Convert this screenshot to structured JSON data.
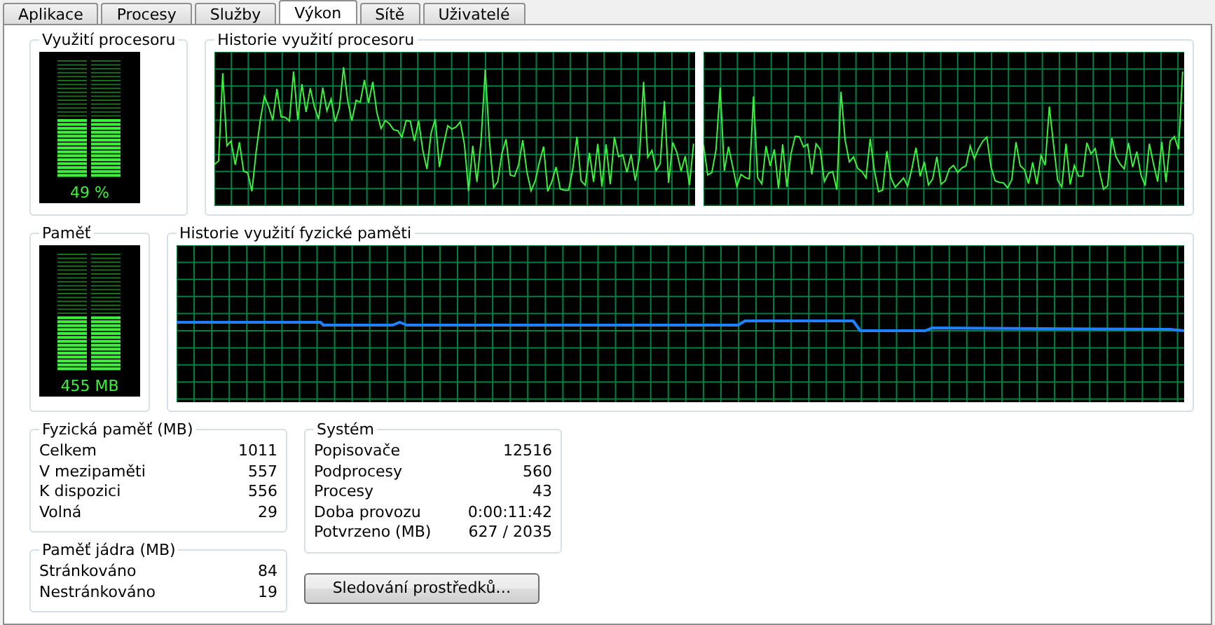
{
  "tabs": [
    {
      "label": "Aplikace",
      "selected": false
    },
    {
      "label": "Procesy",
      "selected": false
    },
    {
      "label": "Služby",
      "selected": false
    },
    {
      "label": "Výkon",
      "selected": true
    },
    {
      "label": "Sítě",
      "selected": false
    },
    {
      "label": "Uživatelé",
      "selected": false
    }
  ],
  "cpu_usage": {
    "title": "Využití procesoru",
    "level": 0.49,
    "reading": "49 %"
  },
  "cpu_history": {
    "title": "Historie využití procesoru"
  },
  "memory": {
    "title": "Paměť",
    "level": 0.45,
    "reading": "455 MB"
  },
  "memory_history": {
    "title": "Historie využití fyzické paměti"
  },
  "physical_memory": {
    "title": "Fyzická paměť (MB)",
    "rows": [
      {
        "label": "Celkem",
        "value": "1011"
      },
      {
        "label": "V mezipaměti",
        "value": "557"
      },
      {
        "label": "K dispozici",
        "value": "556"
      },
      {
        "label": "Volná",
        "value": "29"
      }
    ]
  },
  "kernel_memory": {
    "title": "Paměť jádra (MB)",
    "rows": [
      {
        "label": "Stránkováno",
        "value": "84"
      },
      {
        "label": "Nestránkováno",
        "value": "19"
      }
    ]
  },
  "system": {
    "title": "Systém",
    "rows": [
      {
        "label": "Popisovače",
        "value": "12516"
      },
      {
        "label": "Podprocesy",
        "value": "560"
      },
      {
        "label": "Procesy",
        "value": "43"
      },
      {
        "label": "Doba provozu",
        "value": "0:00:11:42"
      },
      {
        "label": "Potvrzeno (MB)",
        "value": "627 / 2035"
      }
    ]
  },
  "resource_monitor_button": "Sledování prostředků…"
}
